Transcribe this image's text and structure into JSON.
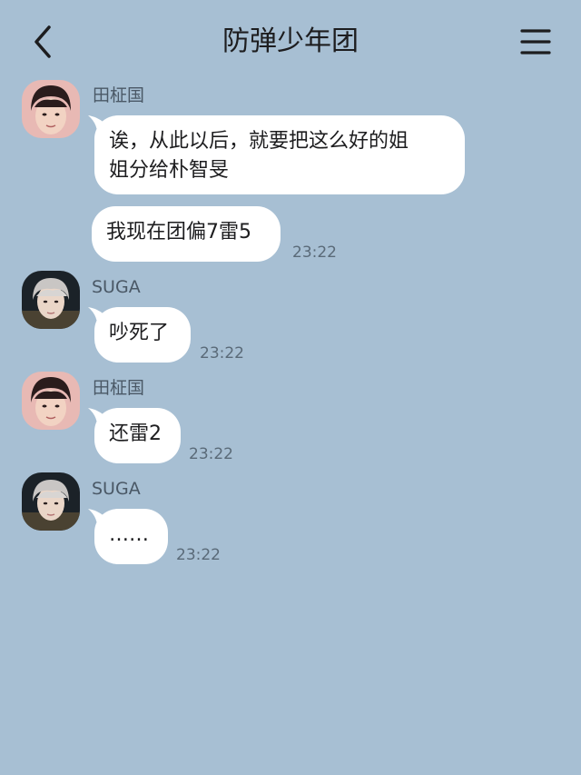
{
  "header": {
    "title": "防弹少年团",
    "back_icon": "chevron-left-icon",
    "menu_icon": "hamburger-menu-icon"
  },
  "colors": {
    "background": "#A7BFD3",
    "bubble": "#FFFFFF",
    "text": "#1D1D1F",
    "sender_text": "#4A5866",
    "time_text": "#5A6A78"
  },
  "messages": [
    {
      "sender": "田柾国",
      "bubbles": [
        {
          "lines": [
            "诶，从此以后，就要把这么好的姐",
            "姐分给朴智旻"
          ],
          "time": ""
        },
        {
          "lines": [
            "我现在团偏7雷5"
          ],
          "time": "23:22"
        }
      ]
    },
    {
      "sender": "SUGA",
      "bubbles": [
        {
          "lines": [
            "吵死了"
          ],
          "time": "23:22"
        }
      ]
    },
    {
      "sender": "田柾国",
      "bubbles": [
        {
          "lines": [
            "还雷2"
          ],
          "time": "23:22"
        }
      ]
    },
    {
      "sender": "SUGA",
      "bubbles": [
        {
          "lines": [
            "……"
          ],
          "time": "23:22"
        }
      ]
    }
  ]
}
